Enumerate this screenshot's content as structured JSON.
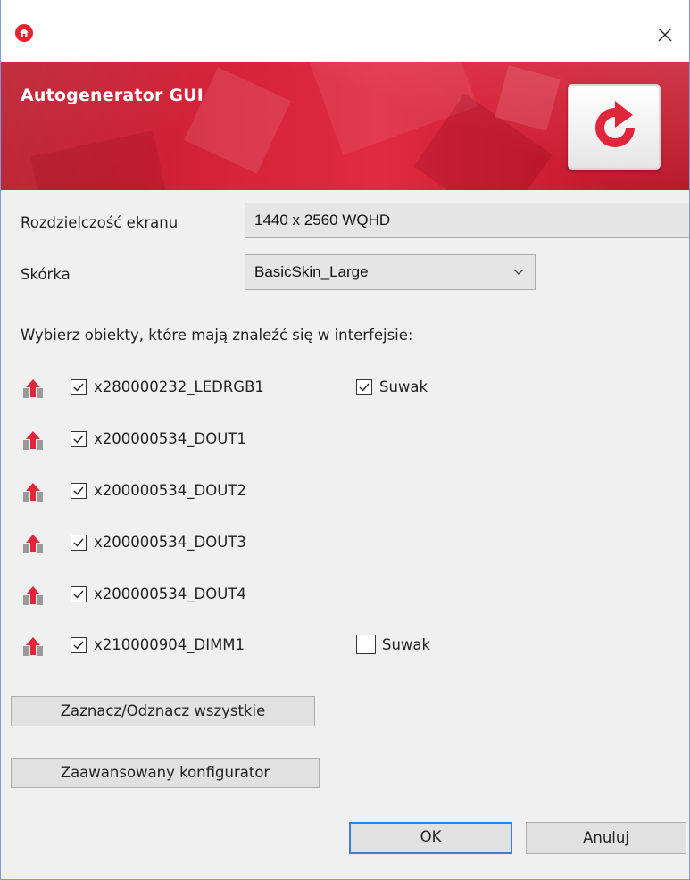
{
  "window": {
    "close_glyph": "×",
    "icons": {
      "app": "app-home-icon",
      "close": "close-icon"
    }
  },
  "banner": {
    "title": "Autogenerator GUI",
    "refresh_icon": "refresh-icon",
    "accent_color": "#d42338"
  },
  "form": {
    "resolution_label": "Rozdzielczość ekranu",
    "resolution_value": "1440 x 2560 WQHD",
    "skin_label": "Skórka",
    "skin_value": "BasicSkin_Large"
  },
  "objects": {
    "heading": "Wybierz obiekty, które mają znaleźć się w interfejsie:",
    "items": [
      {
        "name": "x280000232_LEDRGB1",
        "checked": true,
        "slider_label": "Suwak",
        "slider_checked": true
      },
      {
        "name": "x200000534_DOUT1",
        "checked": true
      },
      {
        "name": "x200000534_DOUT2",
        "checked": true
      },
      {
        "name": "x200000534_DOUT3",
        "checked": true
      },
      {
        "name": "x200000534_DOUT4",
        "checked": true
      },
      {
        "name": "x210000904_DIMM1",
        "checked": true,
        "slider_label": "Suwak",
        "slider_checked": false
      }
    ]
  },
  "buttons": {
    "toggle_all": "Zaznacz/Odznacz wszystkie",
    "advanced": "Zaawansowany konfigurator",
    "ok": "OK",
    "cancel": "Anuluj"
  }
}
